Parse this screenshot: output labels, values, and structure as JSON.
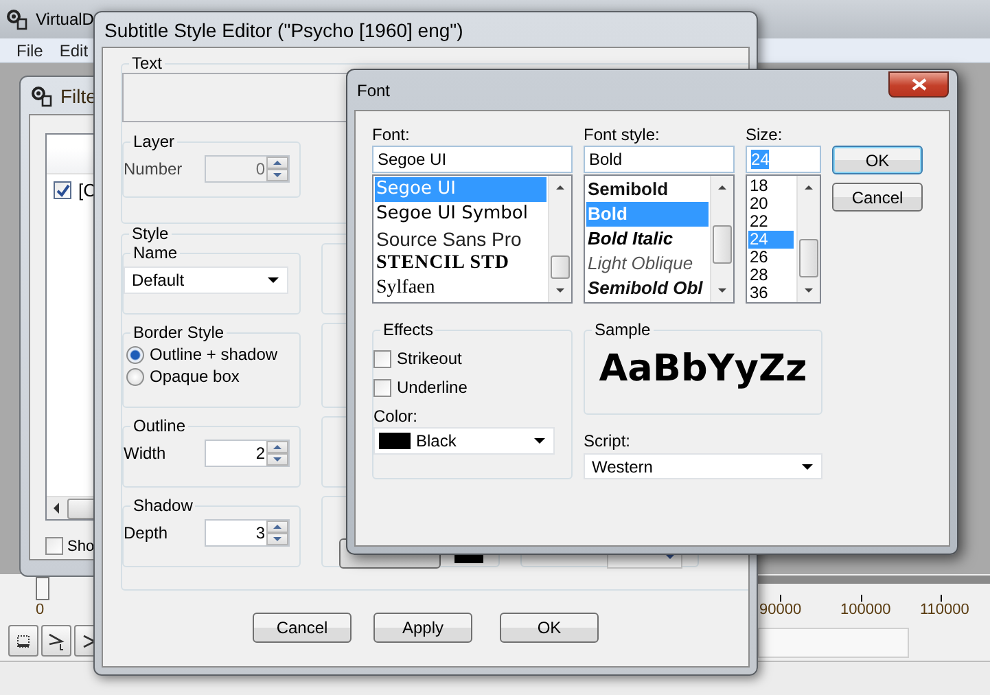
{
  "main_window": {
    "title": "VirtualD",
    "menu": [
      "File",
      "Edit"
    ]
  },
  "filter_window": {
    "title": "Filte",
    "rows": [
      {
        "label": "[C",
        "checked": true
      }
    ],
    "show_option": {
      "label": "Sho",
      "checked": false
    }
  },
  "timeline": {
    "start": "0",
    "ticks": [
      "90000",
      "100000",
      "110000"
    ]
  },
  "style_editor": {
    "title": "Subtitle Style Editor (\"Psycho [1960] eng\")",
    "text_group": "Text",
    "layer": {
      "title": "Layer",
      "label": "Number",
      "value": "0",
      "disabled": true
    },
    "style_group": "Style",
    "name": {
      "title": "Name",
      "value": "Default"
    },
    "border_style": {
      "title": "Border Style",
      "options": [
        {
          "label": "Outline + shadow",
          "selected": true
        },
        {
          "label": "Opaque box",
          "selected": false
        }
      ]
    },
    "outline": {
      "title": "Outline",
      "label": "Width",
      "value": "2"
    },
    "shadow": {
      "title": "Shadow",
      "label": "Depth",
      "value": "3"
    },
    "buttons": [
      "Cancel",
      "Apply",
      "OK"
    ]
  },
  "font_dialog": {
    "title": "Font",
    "font": {
      "label": "Font:",
      "value": "Segoe UI",
      "items": [
        {
          "label": "Segoe UI",
          "kind": "sans",
          "selected": true
        },
        {
          "label": "Segoe UI Symbol",
          "kind": "sans",
          "selected": false
        },
        {
          "label": "Source Sans Pro",
          "kind": "light",
          "selected": false
        },
        {
          "label": "STENCIL STD",
          "kind": "stencil",
          "selected": false
        },
        {
          "label": "Sylfaen",
          "kind": "serif",
          "selected": false
        }
      ]
    },
    "style": {
      "label": "Font style:",
      "value": "Bold",
      "items": [
        {
          "label": "Semibold",
          "kind": "semibold",
          "selected": false
        },
        {
          "label": "Bold",
          "kind": "bold",
          "selected": true
        },
        {
          "label": "Bold Italic",
          "kind": "bold-italic",
          "selected": false
        },
        {
          "label": "Light Oblique",
          "kind": "light-italic",
          "selected": false
        },
        {
          "label": "Semibold Obl",
          "kind": "semibold-italic",
          "selected": false
        }
      ]
    },
    "size": {
      "label": "Size:",
      "value": "24",
      "items": [
        {
          "label": "18",
          "selected": false
        },
        {
          "label": "20",
          "selected": false
        },
        {
          "label": "22",
          "selected": false
        },
        {
          "label": "24",
          "selected": true
        },
        {
          "label": "26",
          "selected": false
        },
        {
          "label": "28",
          "selected": false
        },
        {
          "label": "36",
          "selected": false
        }
      ]
    },
    "buttons": [
      "OK",
      "Cancel"
    ],
    "effects": {
      "title": "Effects",
      "options": [
        {
          "label": "Strikeout",
          "checked": false
        },
        {
          "label": "Underline",
          "checked": false
        }
      ],
      "color_label": "Color:",
      "color_value": "Black"
    },
    "sample": {
      "title": "Sample",
      "text": "AaBbYyZz"
    },
    "script": {
      "label": "Script:",
      "value": "Western"
    }
  }
}
